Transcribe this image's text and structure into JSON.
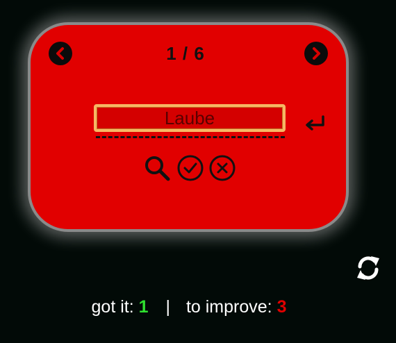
{
  "card": {
    "counter": "1 / 6",
    "answer_value": "Laube",
    "icons": {
      "prev": "chevron-left-circle-icon",
      "next": "chevron-right-circle-icon",
      "enter": "enter-return-icon",
      "search": "search-icon",
      "check": "check-circle-icon",
      "clear": "close-circle-icon"
    },
    "colors": {
      "card_background": "#e10000",
      "card_border": "#8a8a8a",
      "input_border": "#f7b764"
    }
  },
  "refresh_icon": "refresh-icon",
  "score": {
    "got_label": "got it:",
    "got_count": "1",
    "separator": "|",
    "improve_label": "to improve:",
    "improve_count": "3",
    "colors": {
      "got_count": "#2fe12f",
      "improve_count": "#e10000"
    }
  }
}
